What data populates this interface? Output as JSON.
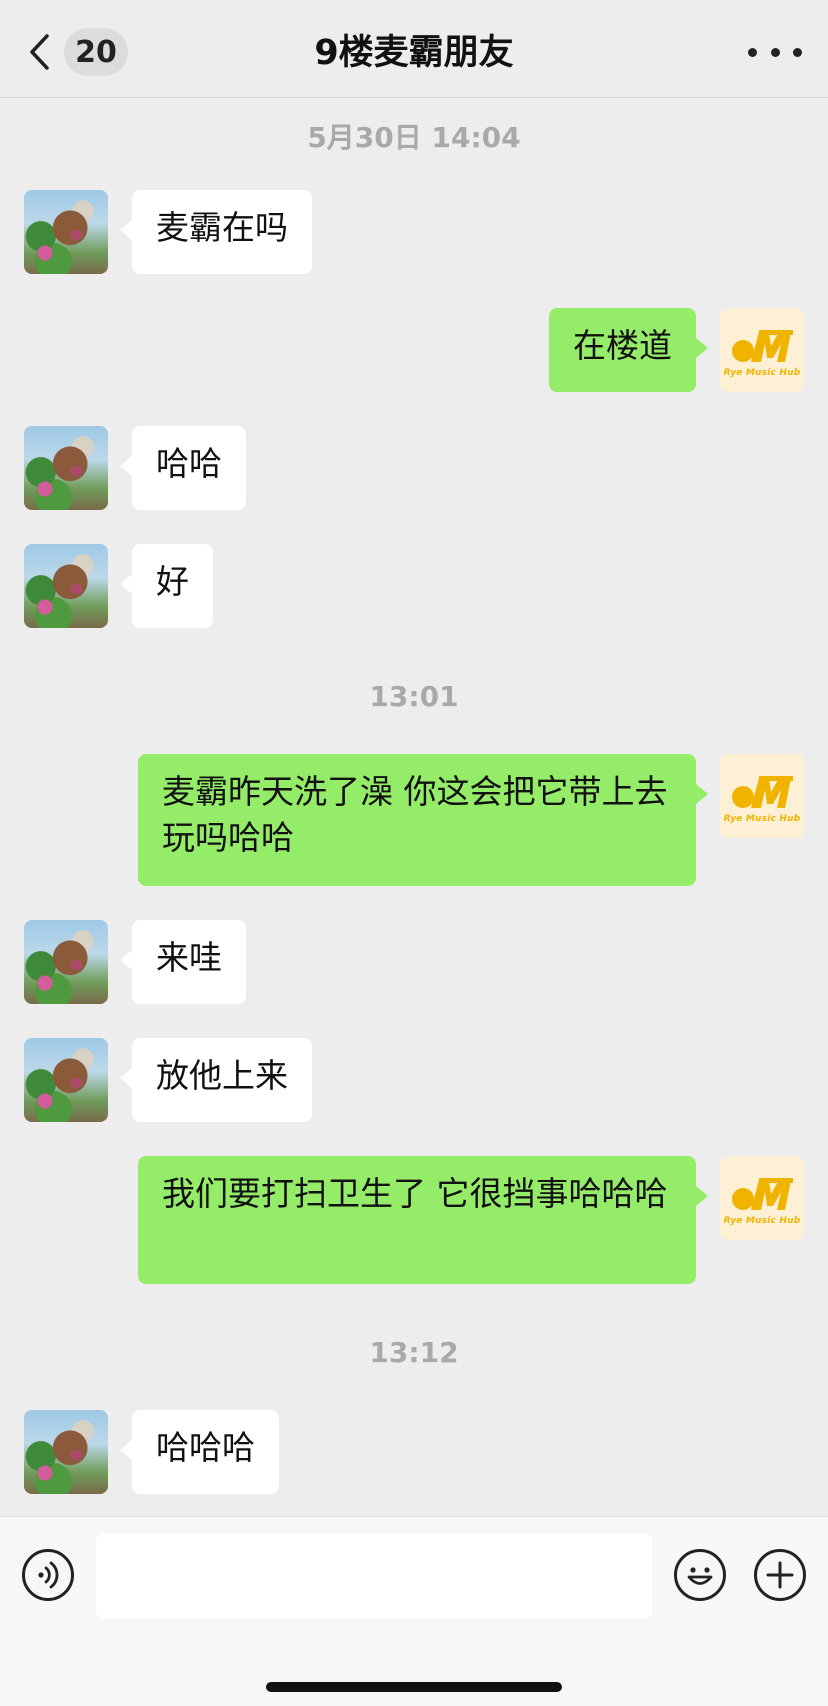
{
  "header": {
    "back_badge": "20",
    "title": "9楼麦霸朋友"
  },
  "timestamps": [
    "5月30日 14:04",
    "13:01",
    "13:12"
  ],
  "messages": [
    {
      "side": "in",
      "text": "麦霸在吗"
    },
    {
      "side": "out",
      "text": "在楼道"
    },
    {
      "side": "in",
      "text": "哈哈"
    },
    {
      "side": "in",
      "text": "好"
    },
    {
      "side": "out",
      "text": "麦霸昨天洗了澡 你这会把它带上去玩吗哈哈"
    },
    {
      "side": "in",
      "text": "来哇"
    },
    {
      "side": "in",
      "text": "放他上来"
    },
    {
      "side": "out",
      "text": "我们要打扫卫生了 它很挡事哈哈哈"
    },
    {
      "side": "in",
      "text": "哈哈哈"
    }
  ],
  "self_avatar_text": "Rye Music Hub",
  "input": {
    "value": "",
    "placeholder": ""
  },
  "icons": {
    "back": "chevron-left-icon",
    "more": "more-icon",
    "voice": "voice-icon",
    "emoji": "emoji-icon",
    "plus": "plus-icon"
  },
  "colors": {
    "outgoing_bubble": "#95ec69",
    "incoming_bubble": "#ffffff",
    "background": "#ededed",
    "logo_accent": "#f0b400"
  }
}
